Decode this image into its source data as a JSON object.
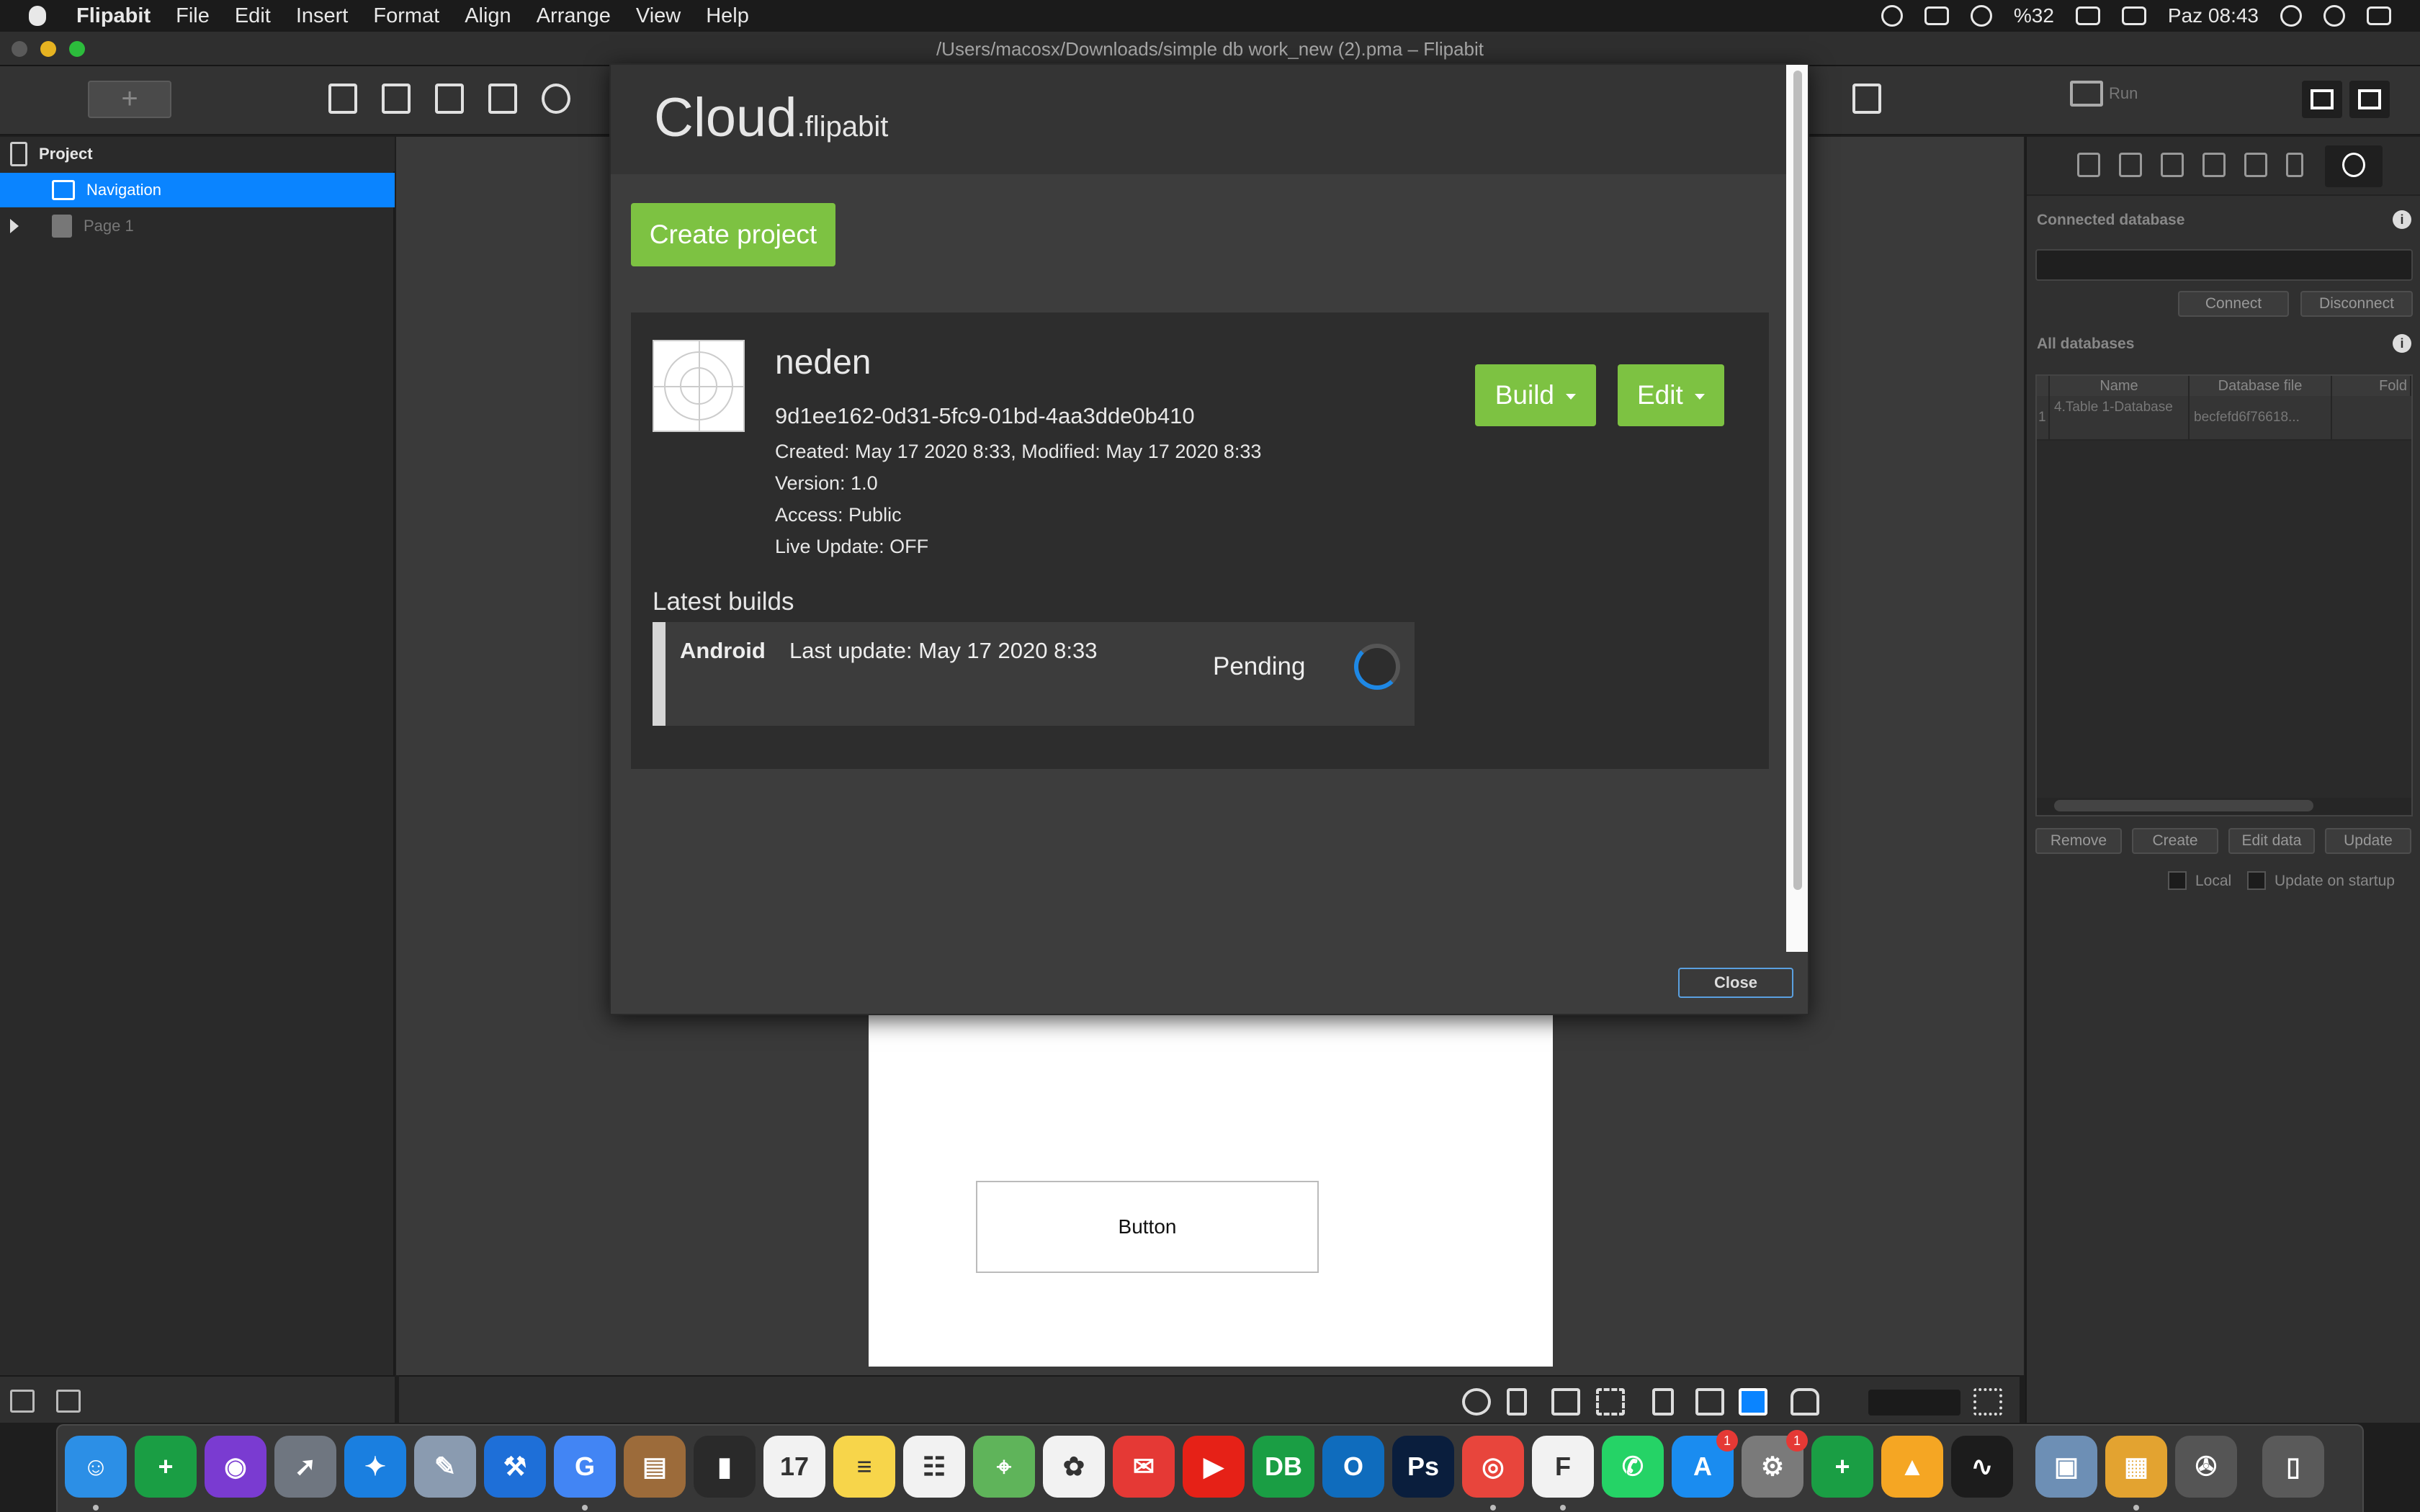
{
  "menubar": {
    "app_name": "Flipabit",
    "items": [
      "File",
      "Edit",
      "Insert",
      "Format",
      "Align",
      "Arrange",
      "View",
      "Help"
    ],
    "battery": "%32",
    "clock": "Paz 08:43"
  },
  "window": {
    "title": "/Users/macosx/Downloads/simple db work_new (2).pma – Flipabit"
  },
  "toolbar": {
    "add_label": "+",
    "run_label": "Run"
  },
  "sidebar": {
    "items": [
      {
        "label": "Project"
      },
      {
        "label": "Navigation"
      },
      {
        "label": "Page 1"
      }
    ]
  },
  "canvas": {
    "button_label": "Button"
  },
  "right_panel": {
    "connected_db_label": "Connected database",
    "connect_label": "Connect",
    "disconnect_label": "Disconnect",
    "all_db_label": "All databases",
    "columns": [
      "Name",
      "Database file",
      "Fold"
    ],
    "rows": [
      {
        "index": "1",
        "name": "4.Table 1-Database",
        "file": "becfefd6f76618..."
      }
    ],
    "actions": [
      "Remove",
      "Create",
      "Edit data",
      "Update"
    ],
    "local_label": "Local",
    "update_on_startup_label": "Update on startup"
  },
  "modal": {
    "logo_main": "Cloud",
    "logo_suffix": ".flipabit",
    "create_project_label": "Create project",
    "project": {
      "name": "neden",
      "id": "9d1ee162-0d31-5fc9-01bd-4aa3dde0b410",
      "created": "Created: May 17 2020 8:33, Modified: May 17 2020 8:33",
      "version": "Version: 1.0",
      "access": "Access: Public",
      "live_update": "Live Update: OFF",
      "build_label": "Build",
      "edit_label": "Edit"
    },
    "latest_builds_label": "Latest builds",
    "build": {
      "platform": "Android",
      "last_update": "Last update: May 17 2020 8:33",
      "status": "Pending"
    },
    "close_label": "Close"
  },
  "dock": {
    "apps": [
      {
        "name": "finder",
        "glyph": "☺",
        "color": "#2c8fe6",
        "running": true
      },
      {
        "name": "numbers",
        "glyph": "+",
        "color": "#1a9e44",
        "running": false
      },
      {
        "name": "siri",
        "glyph": "◉",
        "color": "#7a3bd1",
        "running": false
      },
      {
        "name": "launchpad",
        "glyph": "➚",
        "color": "#6f7680",
        "running": false
      },
      {
        "name": "safari",
        "glyph": "✦",
        "color": "#1a7fe0",
        "running": false
      },
      {
        "name": "preview",
        "glyph": "✎",
        "color": "#8a9bb0",
        "running": false
      },
      {
        "name": "xcode",
        "glyph": "⚒",
        "color": "#1e6fd8",
        "running": false
      },
      {
        "name": "translate",
        "glyph": "G",
        "color": "#4285f4",
        "running": true
      },
      {
        "name": "notebook",
        "glyph": "▤",
        "color": "#9c6b3a",
        "running": false
      },
      {
        "name": "charts",
        "glyph": "▮",
        "color": "#2a2a2a",
        "running": false
      },
      {
        "name": "calendar",
        "glyph": "17",
        "color": "#f2f2f2",
        "running": false
      },
      {
        "name": "notes",
        "glyph": "≡",
        "color": "#f7d54a",
        "running": false
      },
      {
        "name": "reminders",
        "glyph": "☷",
        "color": "#f2f2f2",
        "running": false
      },
      {
        "name": "maps",
        "glyph": "⌖",
        "color": "#5fb45a",
        "running": false
      },
      {
        "name": "photos",
        "glyph": "✿",
        "color": "#f2f2f2",
        "running": false
      },
      {
        "name": "mail",
        "glyph": "✉",
        "color": "#e53935",
        "running": false
      },
      {
        "name": "youtube",
        "glyph": "▶",
        "color": "#e62117",
        "running": false
      },
      {
        "name": "db-browser",
        "glyph": "DB",
        "color": "#1a9e44",
        "running": false
      },
      {
        "name": "outlook",
        "glyph": "O",
        "color": "#0f6cbd",
        "running": false
      },
      {
        "name": "photoshop",
        "glyph": "Ps",
        "color": "#0a1e3d",
        "running": false
      },
      {
        "name": "chrome",
        "glyph": "◎",
        "color": "#e8453c",
        "running": true
      },
      {
        "name": "flipabit",
        "glyph": "F",
        "color": "#f2f2f2",
        "running": true
      },
      {
        "name": "whatsapp",
        "glyph": "✆",
        "color": "#25d366",
        "running": false
      },
      {
        "name": "app-store",
        "glyph": "A",
        "color": "#1a8cf0",
        "running": false,
        "badge": "1"
      },
      {
        "name": "system-preferences",
        "glyph": "⚙",
        "color": "#7a7a7a",
        "running": false,
        "badge": "1"
      },
      {
        "name": "sheets",
        "glyph": "+",
        "color": "#1a9e44",
        "running": false
      },
      {
        "name": "firebase",
        "glyph": "▲",
        "color": "#f5a623",
        "running": false
      },
      {
        "name": "activity-monitor",
        "glyph": "∿",
        "color": "#1c1c1c",
        "running": false
      },
      {
        "name": "image-viewer",
        "glyph": "▣",
        "color": "#6d8fb5",
        "running": false
      },
      {
        "name": "archive",
        "glyph": "▦",
        "color": "#e3a330",
        "running": true
      },
      {
        "name": "automator",
        "glyph": "✇",
        "color": "#555",
        "running": false
      },
      {
        "name": "trash",
        "glyph": "▯",
        "color": "#5a5a5a",
        "running": false
      }
    ]
  }
}
